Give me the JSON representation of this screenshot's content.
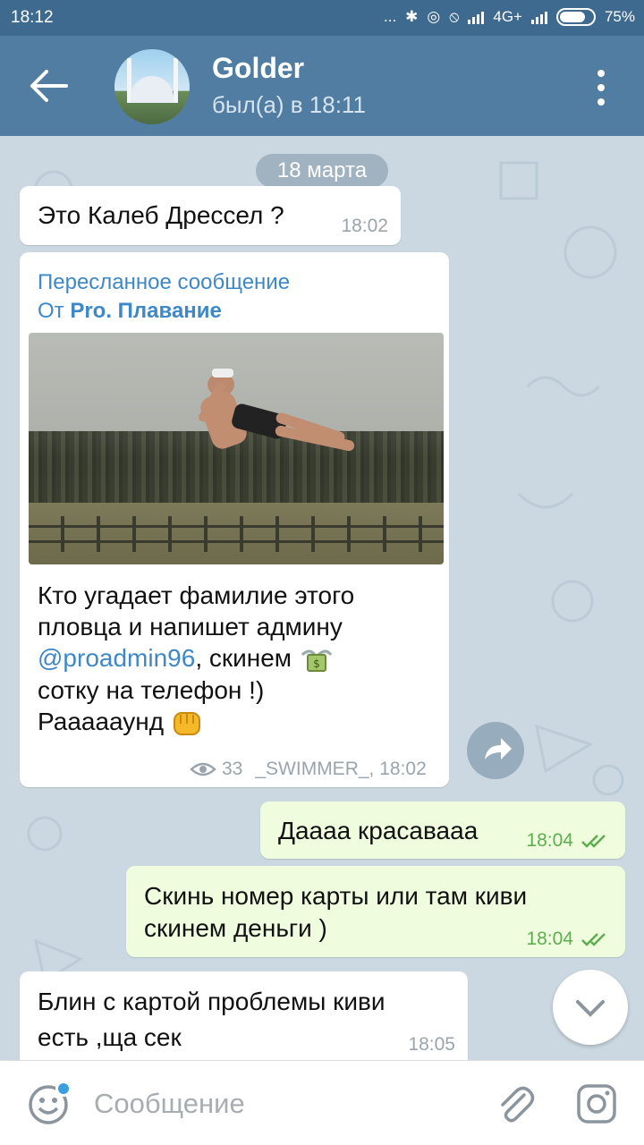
{
  "status_bar": {
    "time": "18:12",
    "dots": "...",
    "network": "4G+",
    "battery": "75%"
  },
  "header": {
    "title": "Golder",
    "subtitle": "был(а) в 18:11"
  },
  "date_label": "18 марта",
  "messages": [
    {
      "direction": "in",
      "text": "Это  Калеб Дрессел ?",
      "time": "18:02"
    },
    {
      "direction": "in",
      "forwarded_label": "Пересланное сообщение",
      "from_prefix": "От ",
      "from_name": "Pro. Плавание",
      "text_line1": "Кто угадает фамилие этого",
      "text_line2": "пловца и напишет админу",
      "mention": "@proadmin96",
      "text_after_mention": ", скинем",
      "text_line4": "сотку на телефон !)",
      "text_line5": "Раааааунд",
      "views": "33",
      "author_time": "_SWIMMER_, 18:02"
    },
    {
      "direction": "out",
      "text": "Даааа красаваaa",
      "time": "18:04"
    },
    {
      "direction": "out",
      "text_line1": "Скинь номер  карты или там киви",
      "text_line2": "скинем деньги )",
      "time": "18:04"
    },
    {
      "direction": "in",
      "text_line1": "Блин с картой проблемы киви",
      "text_line2": "есть ,ща сек",
      "time": "18:05"
    }
  ],
  "input": {
    "placeholder": "Сообщение"
  },
  "colors": {
    "header": "#517da2",
    "status_bar": "#3d6a8e",
    "outgoing_bubble": "#effdde",
    "link": "#3e88c7"
  }
}
